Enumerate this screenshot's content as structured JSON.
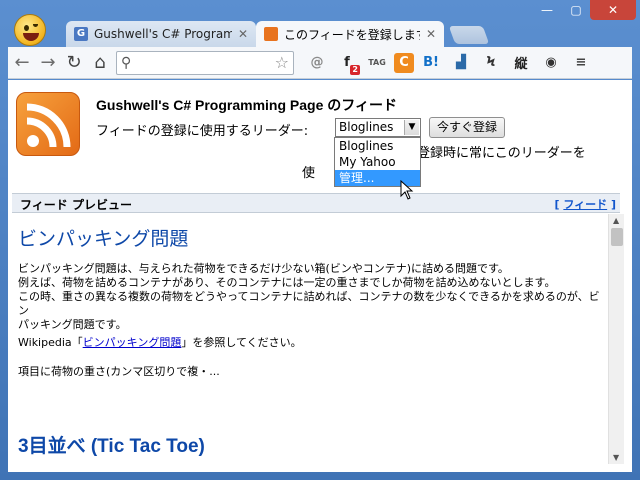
{
  "tabs": [
    {
      "label": "Gushwell's C# Program",
      "favicon_color": "#4a78c2",
      "favicon_letter": "G"
    },
    {
      "label": "このフィードを登録します",
      "favicon_color": "#e8731e"
    }
  ],
  "window_controls": {
    "minimize": "—",
    "maximize": "▢",
    "close": "✕"
  },
  "toolbar": {
    "back": "←",
    "forward": "→",
    "reload": "↻",
    "home": "⌂",
    "search_glyph": "⚲",
    "star": "☆",
    "extensions": [
      {
        "name": "at-icon",
        "glyph": "@",
        "color": "#8a8a8a"
      },
      {
        "name": "facebook-icon",
        "glyph": "f",
        "color": "#222"
      },
      {
        "name": "tag-icon",
        "glyph": "TAG",
        "color": "#555"
      },
      {
        "name": "c-icon",
        "glyph": "C",
        "color": "#f08b1f"
      },
      {
        "name": "hatena-bookmark-icon",
        "glyph": "B!",
        "color": "#1170c8"
      },
      {
        "name": "chart-icon",
        "glyph": "▟",
        "color": "#2b6aa8"
      },
      {
        "name": "pen-icon",
        "glyph": "Ϟ",
        "color": "#333"
      },
      {
        "name": "vertical-text-icon",
        "glyph": "縦",
        "color": "#222"
      },
      {
        "name": "camera-icon",
        "glyph": "◉",
        "color": "#333"
      },
      {
        "name": "menu-icon",
        "glyph": "≡",
        "color": "#444"
      }
    ],
    "facebook_badge": "2"
  },
  "feed": {
    "title": "Gushwell's C# Programming Page のフィード",
    "reader_label": "フィードの登録に使用するリーダー:",
    "selected_reader": "Bloglines",
    "subscribe_button": "今すぐ登録",
    "always_text_1": "登録時に常にこのリーダーを",
    "always_text_2": "使",
    "reader_options": [
      "Bloglines",
      "My Yahoo",
      "管理..."
    ],
    "highlighted_option_index": 2
  },
  "preview": {
    "header": "フィード プレビュー",
    "feed_link_prefix": "[ ",
    "feed_link": "フィード",
    "feed_link_suffix": " ]"
  },
  "entries": [
    {
      "title": "ビンパッキング問題",
      "lines": [
        "ビンパッキング問題は、与えられた荷物をできるだけ少ない箱(ビンやコンテナ)に詰める問題です。",
        "例えば、荷物を詰めるコンテナがあり、そのコンテナには一定の重さまでしか荷物を詰め込めないとします。",
        "この時、重さの異なる複数の荷物をどうやってコンテナに詰めれば、コンテナの数を少なくできるかを求めるのが、ビン",
        "パッキング問題です。"
      ],
      "wiki_prefix": "Wikipedia「",
      "wiki_link": "ビンパッキング問題",
      "wiki_suffix": "」を参照してください。",
      "snippet": "項目に荷物の重さ(カンマ区切りで複・..."
    },
    {
      "title": "3目並べ (Tic Tac Toe)"
    }
  ]
}
